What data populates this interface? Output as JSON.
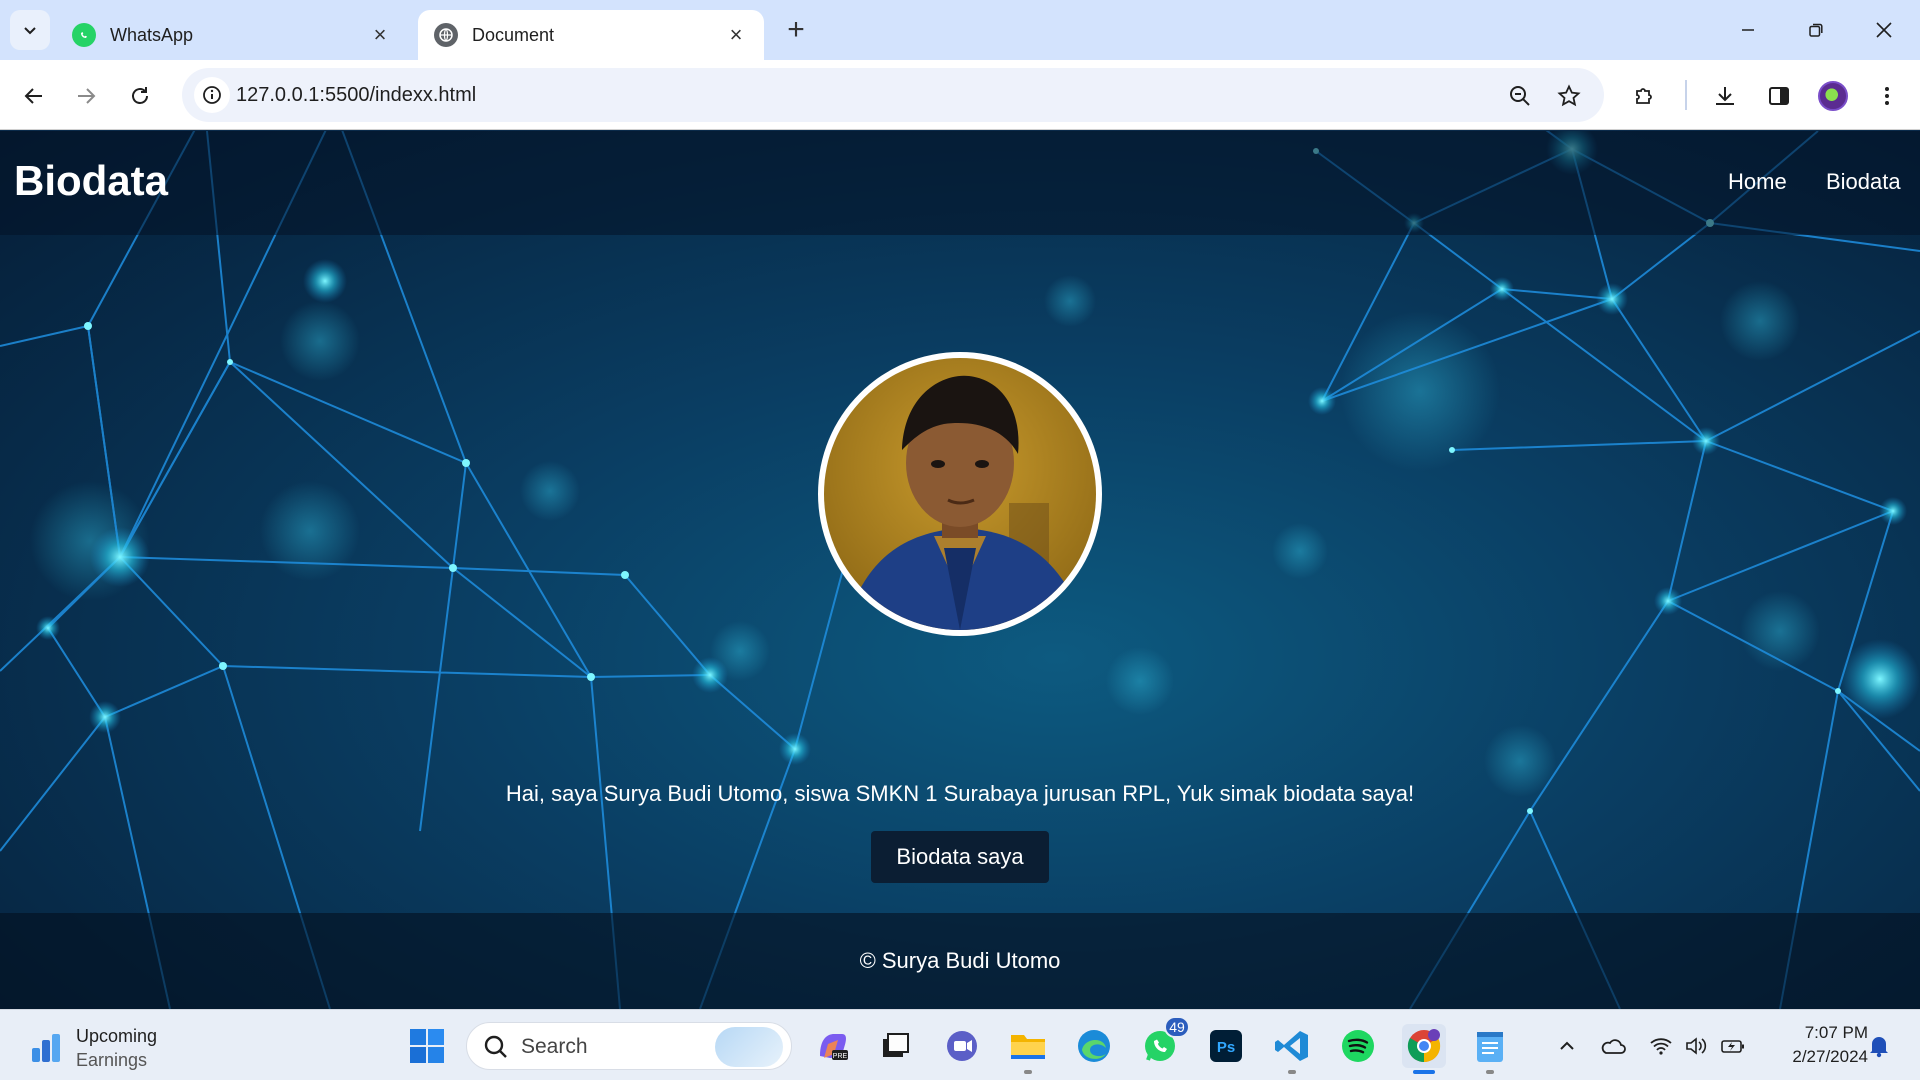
{
  "browser": {
    "tabs": [
      {
        "title": "WhatsApp",
        "active": false,
        "icon": "whatsapp-icon"
      },
      {
        "title": "Document",
        "active": true,
        "icon": "globe-icon"
      }
    ],
    "url": "127.0.0.1:5500/indexx.html"
  },
  "site": {
    "brand": "Biodata",
    "nav": [
      {
        "label": "Home"
      },
      {
        "label": "Biodata"
      }
    ],
    "intro_text": "Hai, saya Surya Budi Utomo, siswa SMKN 1 Surabaya jurusan RPL, Yuk simak biodata saya!",
    "cta_label": "Biodata saya",
    "footer_text": "© Surya Budi Utomo"
  },
  "taskbar": {
    "widget": {
      "line1": "Upcoming",
      "line2": "Earnings"
    },
    "search_placeholder": "Search",
    "whatsapp_badge": "49",
    "clock": {
      "time": "7:07 PM",
      "date": "2/27/2024"
    }
  },
  "colors": {
    "tabstrip": "#d3e3fd",
    "page_background": "#0a3e63",
    "network_lines": "#1f8fe0",
    "network_nodes": "#3fe6ff",
    "cta_background": "#0b1e33"
  }
}
